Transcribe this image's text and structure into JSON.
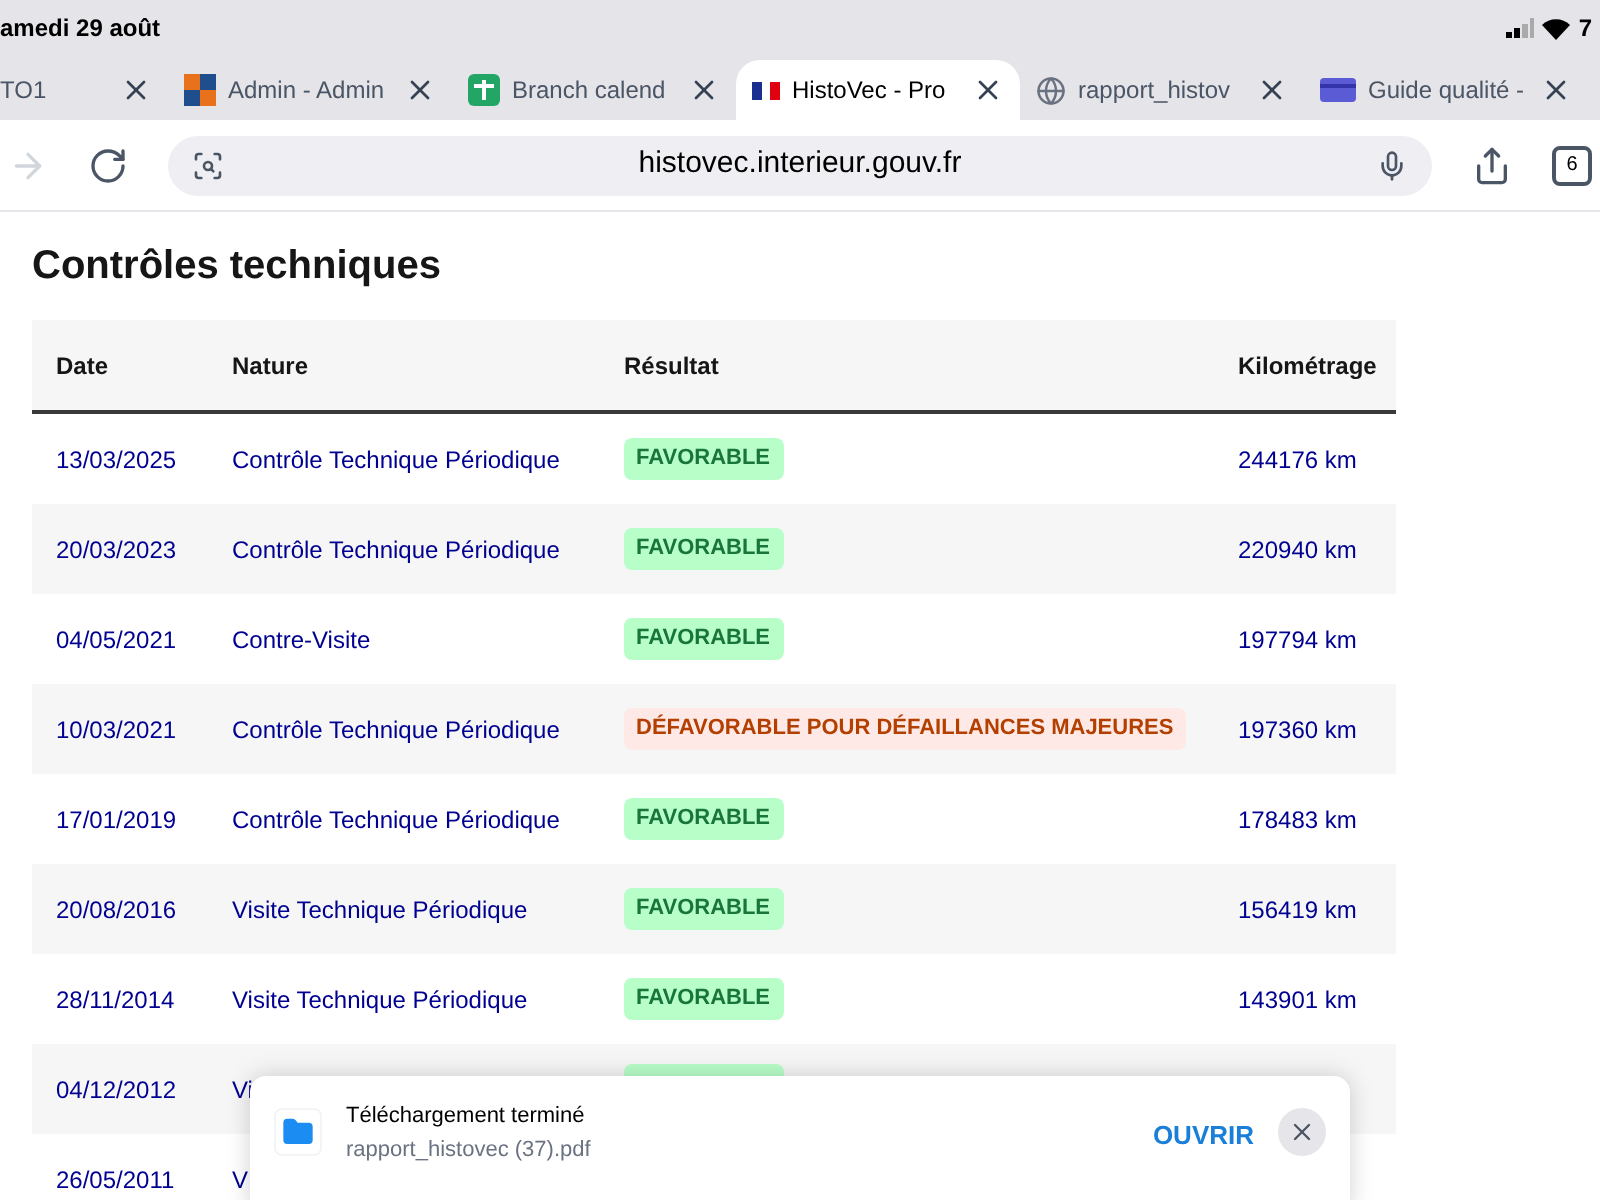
{
  "status_bar": {
    "date": "amedi 29 août",
    "battery": "7"
  },
  "tabs": [
    {
      "title": "TO1",
      "selected": false
    },
    {
      "title": "Admin - Admin",
      "selected": false
    },
    {
      "title": "Branch calend",
      "selected": false
    },
    {
      "title": "HistoVec - Pro",
      "selected": true
    },
    {
      "title": "rapport_histov",
      "selected": false
    },
    {
      "title": "Guide qualité -",
      "selected": false
    }
  ],
  "address_bar": {
    "url": "histovec.interieur.gouv.fr",
    "tab_count": "6"
  },
  "section_title": "Contrôles techniques",
  "table": {
    "columns": [
      "Date",
      "Nature",
      "Résultat",
      "Kilométrage"
    ],
    "rows": [
      {
        "date": "13/03/2025",
        "nature": "Contrôle Technique Périodique",
        "result": "FAVORABLE",
        "kind": "favorable",
        "km": "244176 km"
      },
      {
        "date": "20/03/2023",
        "nature": "Contrôle Technique Périodique",
        "result": "FAVORABLE",
        "kind": "favorable",
        "km": "220940 km"
      },
      {
        "date": "04/05/2021",
        "nature": "Contre-Visite",
        "result": "FAVORABLE",
        "kind": "favorable",
        "km": "197794 km"
      },
      {
        "date": "10/03/2021",
        "nature": "Contrôle Technique Périodique",
        "result": "DÉFAVORABLE POUR DÉFAILLANCES MAJEURES",
        "kind": "defavorable",
        "km": "197360 km"
      },
      {
        "date": "17/01/2019",
        "nature": "Contrôle Technique Périodique",
        "result": "FAVORABLE",
        "kind": "favorable",
        "km": "178483 km"
      },
      {
        "date": "20/08/2016",
        "nature": "Visite Technique Périodique",
        "result": "FAVORABLE",
        "kind": "favorable",
        "km": "156419 km"
      },
      {
        "date": "28/11/2014",
        "nature": "Visite Technique Périodique",
        "result": "FAVORABLE",
        "kind": "favorable",
        "km": "143901 km"
      },
      {
        "date": "04/12/2012",
        "nature": "Vi",
        "kind": "favorable"
      },
      {
        "date": "26/05/2011",
        "nature": "V"
      }
    ]
  },
  "download_toast": {
    "title": "Téléchargement terminé",
    "file": "rapport_histovec (37).pdf",
    "action": "OUVRIR"
  }
}
